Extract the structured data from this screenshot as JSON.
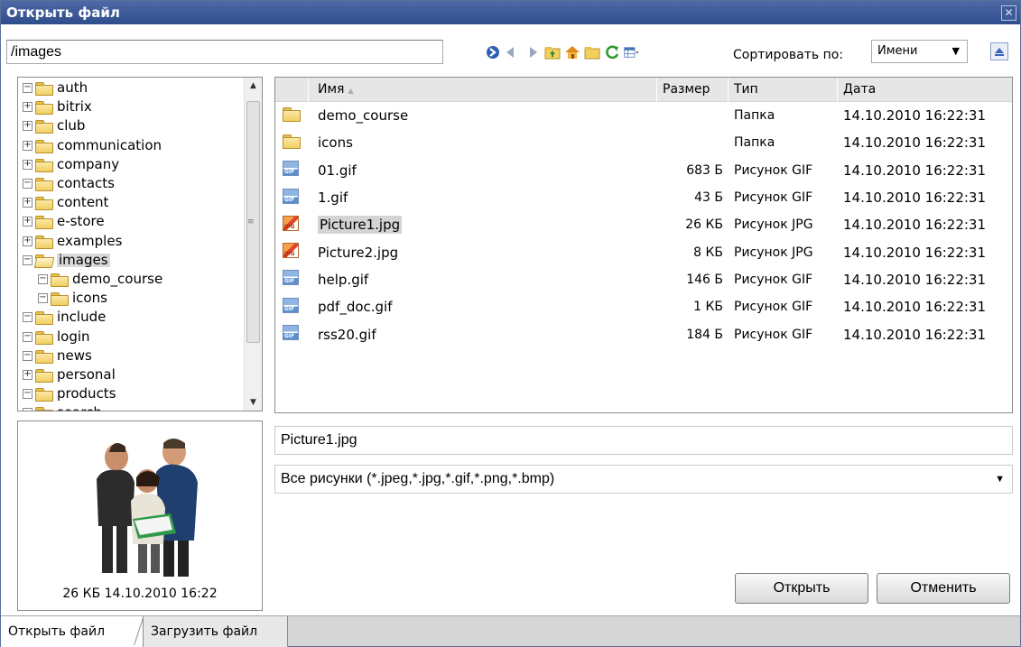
{
  "dialog": {
    "title": "Открыть файл",
    "close_glyph": "✕"
  },
  "path": {
    "value": "/images"
  },
  "toolbar": {
    "icons": [
      "go-icon",
      "back-icon",
      "forward-icon",
      "parent-folder-icon",
      "home-icon",
      "new-folder-icon",
      "refresh-icon",
      "view-mode-icon"
    ]
  },
  "sort": {
    "label": "Сортировать по:",
    "value": "Имени",
    "arrow": "▼"
  },
  "tree": {
    "items": [
      {
        "label": "auth",
        "toggle": "−",
        "level": 0
      },
      {
        "label": "bitrix",
        "toggle": "+",
        "level": 0
      },
      {
        "label": "club",
        "toggle": "+",
        "level": 0
      },
      {
        "label": "communication",
        "toggle": "+",
        "level": 0
      },
      {
        "label": "company",
        "toggle": "+",
        "level": 0
      },
      {
        "label": "contacts",
        "toggle": "−",
        "level": 0
      },
      {
        "label": "content",
        "toggle": "+",
        "level": 0
      },
      {
        "label": "e-store",
        "toggle": "+",
        "level": 0
      },
      {
        "label": "examples",
        "toggle": "+",
        "level": 0
      },
      {
        "label": "images",
        "toggle": "−",
        "level": 0,
        "selected": true,
        "open": true
      },
      {
        "label": "demo_course",
        "toggle": "−",
        "level": 1
      },
      {
        "label": "icons",
        "toggle": "−",
        "level": 1
      },
      {
        "label": "include",
        "toggle": "−",
        "level": 0
      },
      {
        "label": "login",
        "toggle": "−",
        "level": 0
      },
      {
        "label": "news",
        "toggle": "−",
        "level": 0
      },
      {
        "label": "personal",
        "toggle": "+",
        "level": 0
      },
      {
        "label": "products",
        "toggle": "−",
        "level": 0
      },
      {
        "label": "search",
        "toggle": "−",
        "level": 0
      }
    ]
  },
  "files": {
    "columns": {
      "name": "Имя",
      "size": "Размер",
      "type": "Тип",
      "date": "Дата",
      "sort_arrow": "▲"
    },
    "rows": [
      {
        "icon": "folder",
        "name": "demo_course",
        "size": "",
        "type": "Папка",
        "date": "14.10.2010 16:22:31"
      },
      {
        "icon": "folder",
        "name": "icons",
        "size": "",
        "type": "Папка",
        "date": "14.10.2010 16:22:31"
      },
      {
        "icon": "gif",
        "name": "01.gif",
        "size": "683 Б",
        "type": "Рисунок GIF",
        "date": "14.10.2010 16:22:31"
      },
      {
        "icon": "gif",
        "name": "1.gif",
        "size": "43 Б",
        "type": "Рисунок GIF",
        "date": "14.10.2010 16:22:31"
      },
      {
        "icon": "jpg",
        "name": "Picture1.jpg",
        "size": "26 КБ",
        "type": "Рисунок JPG",
        "date": "14.10.2010 16:22:31",
        "selected": true
      },
      {
        "icon": "jpg",
        "name": "Picture2.jpg",
        "size": "8 КБ",
        "type": "Рисунок JPG",
        "date": "14.10.2010 16:22:31"
      },
      {
        "icon": "gif",
        "name": "help.gif",
        "size": "146 Б",
        "type": "Рисунок GIF",
        "date": "14.10.2010 16:22:31"
      },
      {
        "icon": "gif",
        "name": "pdf_doc.gif",
        "size": "1 КБ",
        "type": "Рисунок GIF",
        "date": "14.10.2010 16:22:31"
      },
      {
        "icon": "gif",
        "name": "rss20.gif",
        "size": "184 Б",
        "type": "Рисунок GIF",
        "date": "14.10.2010 16:22:31"
      }
    ]
  },
  "preview": {
    "caption": "26 КБ 14.10.2010 16:22"
  },
  "filename": {
    "value": "Picture1.jpg"
  },
  "filter": {
    "value": "Все рисунки (*.jpeg,*.jpg,*.gif,*.png,*.bmp)",
    "arrow": "▼"
  },
  "buttons": {
    "open": "Открыть",
    "cancel": "Отменить"
  },
  "tabs": {
    "open_file": "Открыть файл",
    "upload_file": "Загрузить файл"
  },
  "colors": {
    "title_bar": "#3a5896",
    "selection": "#d4d4d4",
    "header_bg": "#e6e6e6"
  }
}
